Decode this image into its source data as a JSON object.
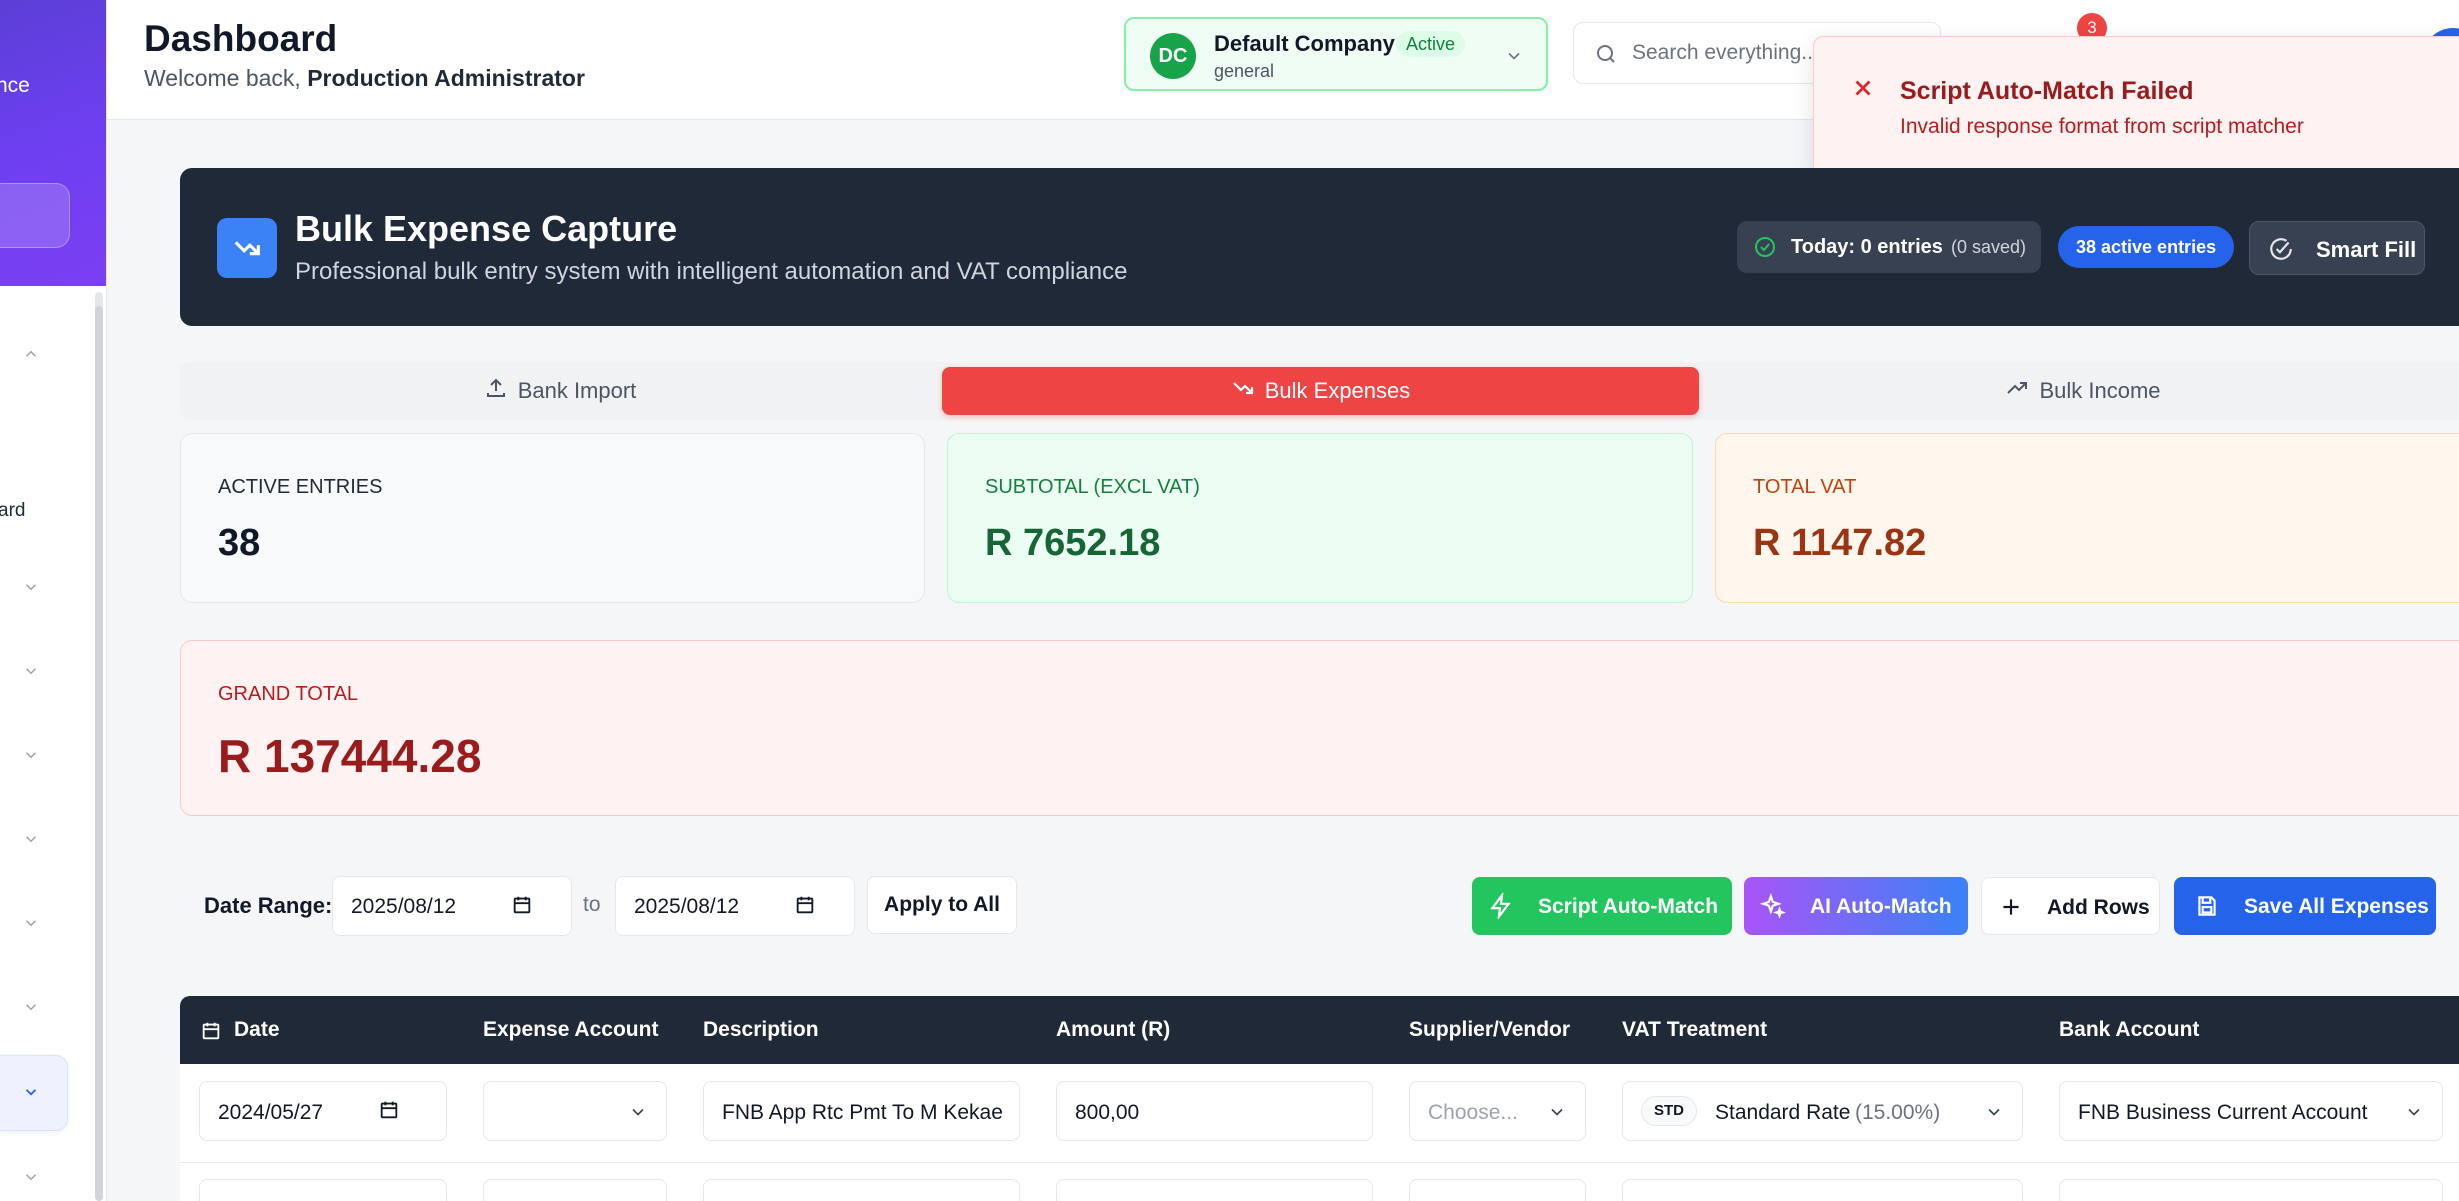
{
  "sidebar": {
    "brand_fragment": "nce",
    "item_fragment": "ard"
  },
  "header": {
    "title": "Dashboard",
    "welcome_prefix": "Welcome back, ",
    "user_name": "Production Administrator"
  },
  "company": {
    "initials": "DC",
    "name": "Default Company",
    "status": "Active",
    "type": "general"
  },
  "search": {
    "placeholder": "Search everything..."
  },
  "notifications": {
    "count": "3"
  },
  "toast": {
    "title": "Script Auto-Match Failed",
    "message": "Invalid response format from script matcher"
  },
  "banner": {
    "title": "Bulk Expense Capture",
    "subtitle": "Professional bulk entry system with intelligent automation and VAT compliance",
    "today_label": "Today: 0 entries",
    "today_saved": "(0 saved)",
    "active_entries": "38 active entries",
    "smart_fill": "Smart Fill"
  },
  "tabs": [
    {
      "label": "Bank Import"
    },
    {
      "label": "Bulk Expenses"
    },
    {
      "label": "Bulk Income"
    }
  ],
  "stats": {
    "active_entries": {
      "label": "ACTIVE ENTRIES",
      "value": "38"
    },
    "subtotal": {
      "label": "SUBTOTAL (EXCL VAT)",
      "value": "R 7652.18"
    },
    "total_vat": {
      "label": "TOTAL VAT",
      "value": "R 1147.82"
    },
    "grand_total": {
      "label": "GRAND TOTAL",
      "value": "R 137444.28"
    }
  },
  "controls": {
    "date_range_label": "Date Range:",
    "date_from": "2025/08/12",
    "to_label": "to",
    "date_to": "2025/08/12",
    "apply_all": "Apply to All",
    "script_auto_match": "Script Auto-Match",
    "ai_auto_match": "AI Auto-Match",
    "add_rows": "Add Rows",
    "save_all": "Save All Expenses"
  },
  "table": {
    "columns": [
      "Date",
      "Expense Account",
      "Description",
      "Amount (R)",
      "Supplier/Vendor",
      "VAT Treatment",
      "Bank Account"
    ],
    "rows": [
      {
        "date": "2024/05/27",
        "expense_account": "",
        "description": "FNB App Rtc Pmt To M Kekae",
        "amount": "800,00",
        "supplier_placeholder": "Choose...",
        "vat_code": "STD",
        "vat_name": "Standard Rate",
        "vat_rate": "(15.00%)",
        "bank_account": "FNB Business Current Account"
      }
    ]
  }
}
